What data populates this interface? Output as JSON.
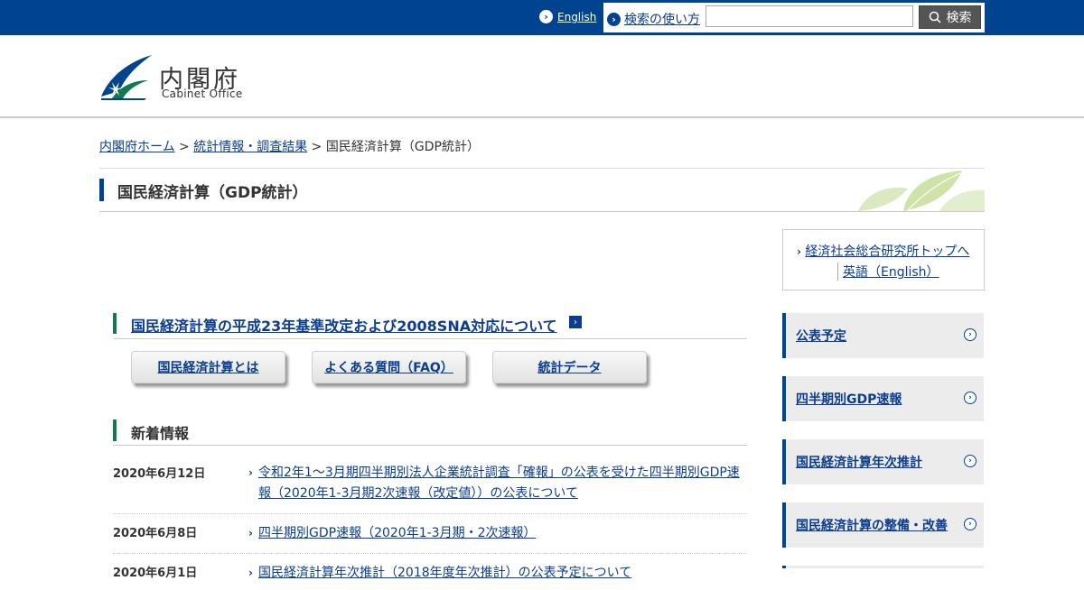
{
  "topbar": {
    "english": "English",
    "search_help": "検索の使い方",
    "search_placeholder": "",
    "search_button": "検索"
  },
  "logo": {
    "jp": "内閣府",
    "en": "Cabinet Office"
  },
  "breadcrumb": {
    "home": "内閣府ホーム",
    "sep1": " > ",
    "stats": "統計情報・調査結果",
    "sep2": " > ",
    "current": "国民経済計算（GDP統計）"
  },
  "page_title": "国民経済計算（GDP統計）",
  "side_links": {
    "top": "経済社会総合研究所トップへ",
    "english": "英語（English）"
  },
  "section1": {
    "title": "国民経済計算の平成23年基準改定および2008SNA対応について"
  },
  "buttons": [
    "国民経済計算とは",
    "よくある質問（FAQ）",
    "統計データ"
  ],
  "news": {
    "heading": "新着情報",
    "items": [
      {
        "date": "2020年6月12日",
        "text": "令和2年1～3月期四半期別法人企業統計調査「確報」の公表を受けた四半期別GDP速報（2020年1-3月期2次速報（改定値））の公表について"
      },
      {
        "date": "2020年6月8日",
        "text": "四半期別GDP速報（2020年1-3月期・2次速報）"
      },
      {
        "date": "2020年6月1日",
        "text": "国民経済計算年次推計（2018年度年次推計）の公表予定について"
      }
    ]
  },
  "right_nav": [
    "公表予定",
    "四半期別GDP速報",
    "国民経済計算年次推計",
    "国民経済計算の整備・改善"
  ],
  "colors": {
    "brand": "#00438e",
    "accent_green": "#0f7a4d",
    "link": "#0b3d91"
  }
}
